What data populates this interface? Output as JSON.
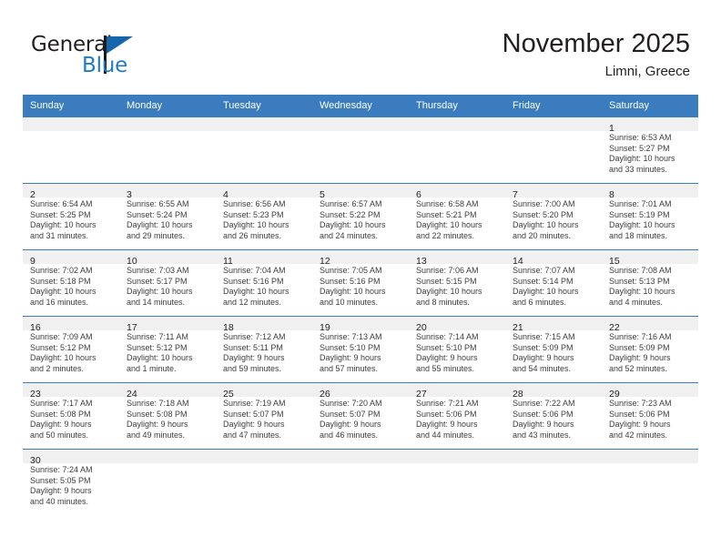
{
  "brand": {
    "name_part1": "General",
    "name_part2": "Blue",
    "flag_icon": "triangle-flag-icon"
  },
  "header": {
    "title": "November 2025",
    "subtitle": "Limni, Greece"
  },
  "calendar": {
    "weekday_headers": [
      "Sunday",
      "Monday",
      "Tuesday",
      "Wednesday",
      "Thursday",
      "Friday",
      "Saturday"
    ],
    "colors": {
      "header_blue": "#3a7cbe",
      "daynum_band": "#f0f0f0",
      "brand_blue": "#1f7bc4",
      "text": "#231f20"
    },
    "weeks": [
      [
        {
          "day": "",
          "sunrise": "",
          "sunset": "",
          "daylight_line1": "",
          "daylight_line2": "",
          "empty": true
        },
        {
          "day": "",
          "sunrise": "",
          "sunset": "",
          "daylight_line1": "",
          "daylight_line2": "",
          "empty": true
        },
        {
          "day": "",
          "sunrise": "",
          "sunset": "",
          "daylight_line1": "",
          "daylight_line2": "",
          "empty": true
        },
        {
          "day": "",
          "sunrise": "",
          "sunset": "",
          "daylight_line1": "",
          "daylight_line2": "",
          "empty": true
        },
        {
          "day": "",
          "sunrise": "",
          "sunset": "",
          "daylight_line1": "",
          "daylight_line2": "",
          "empty": true
        },
        {
          "day": "",
          "sunrise": "",
          "sunset": "",
          "daylight_line1": "",
          "daylight_line2": "",
          "empty": true
        },
        {
          "day": "1",
          "sunrise": "Sunrise: 6:53 AM",
          "sunset": "Sunset: 5:27 PM",
          "daylight_line1": "Daylight: 10 hours",
          "daylight_line2": "and 33 minutes.",
          "empty": false
        }
      ],
      [
        {
          "day": "2",
          "sunrise": "Sunrise: 6:54 AM",
          "sunset": "Sunset: 5:25 PM",
          "daylight_line1": "Daylight: 10 hours",
          "daylight_line2": "and 31 minutes.",
          "empty": false
        },
        {
          "day": "3",
          "sunrise": "Sunrise: 6:55 AM",
          "sunset": "Sunset: 5:24 PM",
          "daylight_line1": "Daylight: 10 hours",
          "daylight_line2": "and 29 minutes.",
          "empty": false
        },
        {
          "day": "4",
          "sunrise": "Sunrise: 6:56 AM",
          "sunset": "Sunset: 5:23 PM",
          "daylight_line1": "Daylight: 10 hours",
          "daylight_line2": "and 26 minutes.",
          "empty": false
        },
        {
          "day": "5",
          "sunrise": "Sunrise: 6:57 AM",
          "sunset": "Sunset: 5:22 PM",
          "daylight_line1": "Daylight: 10 hours",
          "daylight_line2": "and 24 minutes.",
          "empty": false
        },
        {
          "day": "6",
          "sunrise": "Sunrise: 6:58 AM",
          "sunset": "Sunset: 5:21 PM",
          "daylight_line1": "Daylight: 10 hours",
          "daylight_line2": "and 22 minutes.",
          "empty": false
        },
        {
          "day": "7",
          "sunrise": "Sunrise: 7:00 AM",
          "sunset": "Sunset: 5:20 PM",
          "daylight_line1": "Daylight: 10 hours",
          "daylight_line2": "and 20 minutes.",
          "empty": false
        },
        {
          "day": "8",
          "sunrise": "Sunrise: 7:01 AM",
          "sunset": "Sunset: 5:19 PM",
          "daylight_line1": "Daylight: 10 hours",
          "daylight_line2": "and 18 minutes.",
          "empty": false
        }
      ],
      [
        {
          "day": "9",
          "sunrise": "Sunrise: 7:02 AM",
          "sunset": "Sunset: 5:18 PM",
          "daylight_line1": "Daylight: 10 hours",
          "daylight_line2": "and 16 minutes.",
          "empty": false
        },
        {
          "day": "10",
          "sunrise": "Sunrise: 7:03 AM",
          "sunset": "Sunset: 5:17 PM",
          "daylight_line1": "Daylight: 10 hours",
          "daylight_line2": "and 14 minutes.",
          "empty": false
        },
        {
          "day": "11",
          "sunrise": "Sunrise: 7:04 AM",
          "sunset": "Sunset: 5:16 PM",
          "daylight_line1": "Daylight: 10 hours",
          "daylight_line2": "and 12 minutes.",
          "empty": false
        },
        {
          "day": "12",
          "sunrise": "Sunrise: 7:05 AM",
          "sunset": "Sunset: 5:16 PM",
          "daylight_line1": "Daylight: 10 hours",
          "daylight_line2": "and 10 minutes.",
          "empty": false
        },
        {
          "day": "13",
          "sunrise": "Sunrise: 7:06 AM",
          "sunset": "Sunset: 5:15 PM",
          "daylight_line1": "Daylight: 10 hours",
          "daylight_line2": "and 8 minutes.",
          "empty": false
        },
        {
          "day": "14",
          "sunrise": "Sunrise: 7:07 AM",
          "sunset": "Sunset: 5:14 PM",
          "daylight_line1": "Daylight: 10 hours",
          "daylight_line2": "and 6 minutes.",
          "empty": false
        },
        {
          "day": "15",
          "sunrise": "Sunrise: 7:08 AM",
          "sunset": "Sunset: 5:13 PM",
          "daylight_line1": "Daylight: 10 hours",
          "daylight_line2": "and 4 minutes.",
          "empty": false
        }
      ],
      [
        {
          "day": "16",
          "sunrise": "Sunrise: 7:09 AM",
          "sunset": "Sunset: 5:12 PM",
          "daylight_line1": "Daylight: 10 hours",
          "daylight_line2": "and 2 minutes.",
          "empty": false
        },
        {
          "day": "17",
          "sunrise": "Sunrise: 7:11 AM",
          "sunset": "Sunset: 5:12 PM",
          "daylight_line1": "Daylight: 10 hours",
          "daylight_line2": "and 1 minute.",
          "empty": false
        },
        {
          "day": "18",
          "sunrise": "Sunrise: 7:12 AM",
          "sunset": "Sunset: 5:11 PM",
          "daylight_line1": "Daylight: 9 hours",
          "daylight_line2": "and 59 minutes.",
          "empty": false
        },
        {
          "day": "19",
          "sunrise": "Sunrise: 7:13 AM",
          "sunset": "Sunset: 5:10 PM",
          "daylight_line1": "Daylight: 9 hours",
          "daylight_line2": "and 57 minutes.",
          "empty": false
        },
        {
          "day": "20",
          "sunrise": "Sunrise: 7:14 AM",
          "sunset": "Sunset: 5:10 PM",
          "daylight_line1": "Daylight: 9 hours",
          "daylight_line2": "and 55 minutes.",
          "empty": false
        },
        {
          "day": "21",
          "sunrise": "Sunrise: 7:15 AM",
          "sunset": "Sunset: 5:09 PM",
          "daylight_line1": "Daylight: 9 hours",
          "daylight_line2": "and 54 minutes.",
          "empty": false
        },
        {
          "day": "22",
          "sunrise": "Sunrise: 7:16 AM",
          "sunset": "Sunset: 5:09 PM",
          "daylight_line1": "Daylight: 9 hours",
          "daylight_line2": "and 52 minutes.",
          "empty": false
        }
      ],
      [
        {
          "day": "23",
          "sunrise": "Sunrise: 7:17 AM",
          "sunset": "Sunset: 5:08 PM",
          "daylight_line1": "Daylight: 9 hours",
          "daylight_line2": "and 50 minutes.",
          "empty": false
        },
        {
          "day": "24",
          "sunrise": "Sunrise: 7:18 AM",
          "sunset": "Sunset: 5:08 PM",
          "daylight_line1": "Daylight: 9 hours",
          "daylight_line2": "and 49 minutes.",
          "empty": false
        },
        {
          "day": "25",
          "sunrise": "Sunrise: 7:19 AM",
          "sunset": "Sunset: 5:07 PM",
          "daylight_line1": "Daylight: 9 hours",
          "daylight_line2": "and 47 minutes.",
          "empty": false
        },
        {
          "day": "26",
          "sunrise": "Sunrise: 7:20 AM",
          "sunset": "Sunset: 5:07 PM",
          "daylight_line1": "Daylight: 9 hours",
          "daylight_line2": "and 46 minutes.",
          "empty": false
        },
        {
          "day": "27",
          "sunrise": "Sunrise: 7:21 AM",
          "sunset": "Sunset: 5:06 PM",
          "daylight_line1": "Daylight: 9 hours",
          "daylight_line2": "and 44 minutes.",
          "empty": false
        },
        {
          "day": "28",
          "sunrise": "Sunrise: 7:22 AM",
          "sunset": "Sunset: 5:06 PM",
          "daylight_line1": "Daylight: 9 hours",
          "daylight_line2": "and 43 minutes.",
          "empty": false
        },
        {
          "day": "29",
          "sunrise": "Sunrise: 7:23 AM",
          "sunset": "Sunset: 5:06 PM",
          "daylight_line1": "Daylight: 9 hours",
          "daylight_line2": "and 42 minutes.",
          "empty": false
        }
      ],
      [
        {
          "day": "30",
          "sunrise": "Sunrise: 7:24 AM",
          "sunset": "Sunset: 5:05 PM",
          "daylight_line1": "Daylight: 9 hours",
          "daylight_line2": "and 40 minutes.",
          "empty": false
        },
        {
          "day": "",
          "sunrise": "",
          "sunset": "",
          "daylight_line1": "",
          "daylight_line2": "",
          "empty": true
        },
        {
          "day": "",
          "sunrise": "",
          "sunset": "",
          "daylight_line1": "",
          "daylight_line2": "",
          "empty": true
        },
        {
          "day": "",
          "sunrise": "",
          "sunset": "",
          "daylight_line1": "",
          "daylight_line2": "",
          "empty": true
        },
        {
          "day": "",
          "sunrise": "",
          "sunset": "",
          "daylight_line1": "",
          "daylight_line2": "",
          "empty": true
        },
        {
          "day": "",
          "sunrise": "",
          "sunset": "",
          "daylight_line1": "",
          "daylight_line2": "",
          "empty": true
        },
        {
          "day": "",
          "sunrise": "",
          "sunset": "",
          "daylight_line1": "",
          "daylight_line2": "",
          "empty": true
        }
      ]
    ]
  }
}
